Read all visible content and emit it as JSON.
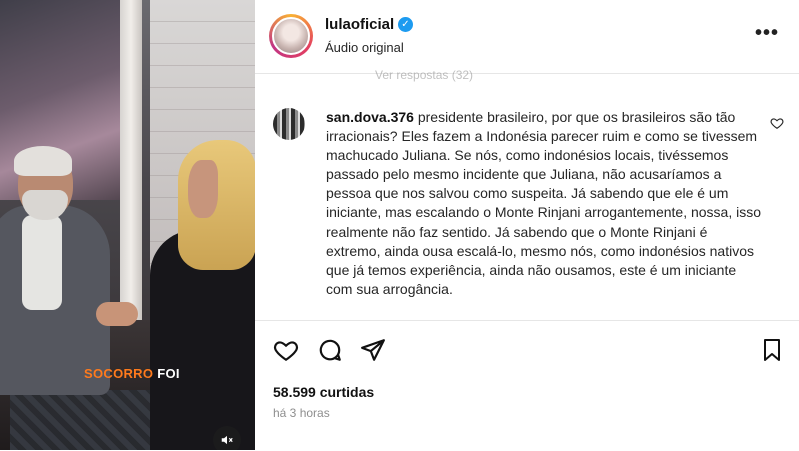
{
  "video": {
    "caption_part1": "SOCORRO",
    "caption_part2": "FOI"
  },
  "post": {
    "username": "lulaoficial",
    "audio_label": "Áudio original",
    "faded_replies": "Ver respostas (32)",
    "comment": {
      "username": "san.dova.376",
      "text": "presidente brasileiro, por que os brasileiros são tão irracionais? Eles fazem a Indonésia parecer ruim e como se tivessem machucado Juliana. Se nós, como indonésios locais, tivéssemos passado pelo mesmo incidente que Juliana, não acusaríamos a pessoa que nos salvou como suspeita. Já sabendo que ele é um iniciante, mas escalando o Monte Rinjani arrogantemente, nossa, isso realmente não faz sentido. Já sabendo que o Monte Rinjani é extremo, ainda ousa escalá-lo, mesmo nós, como indonésios nativos que já temos experiência, ainda não ousamos, este é um iniciante com sua arrogância."
    },
    "likes": "58.599 curtidas",
    "time": "há 3 horas"
  },
  "icons": {
    "verified": "verified-badge-icon",
    "more": "more-options-icon",
    "like": "heart-icon",
    "comment": "comment-icon",
    "share": "share-icon",
    "save": "bookmark-icon",
    "mute": "muted-speaker-icon"
  },
  "colors": {
    "caption_accent": "#ff7a1c",
    "verified_blue": "#1d9bf0"
  }
}
